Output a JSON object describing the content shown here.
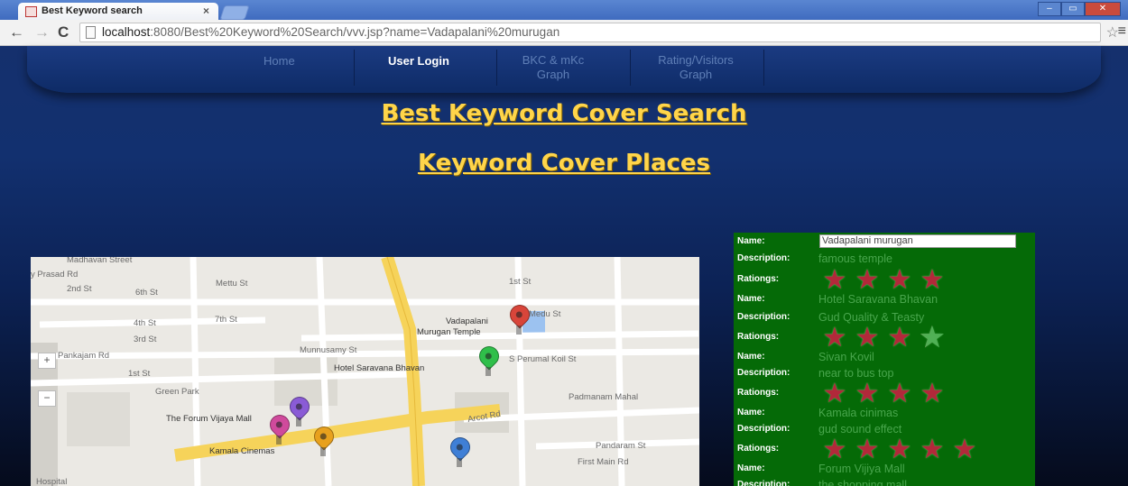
{
  "browser": {
    "tab_title": "Best Keyword search",
    "tab_close": "×",
    "url_host": "localhost",
    "url_rest": ":8080/Best%20Keyword%20Search/vvv.jsp?name=Vadapalani%20murugan",
    "back": "←",
    "forward": "→",
    "reload": "C",
    "star": "☆",
    "menu": "≡",
    "win_min": "–",
    "win_max": "▭",
    "win_close": "✕"
  },
  "nav": {
    "home": "Home",
    "user_login": "User Login",
    "bkc_line1": "BKC & mKc",
    "bkc_line2": "Graph",
    "rating_line1": "Rating/Visitors",
    "rating_line2": "Graph"
  },
  "headings": {
    "main": "Best Keyword Cover Search",
    "sub": "Keyword Cover Places"
  },
  "map": {
    "labels": [
      "Madhavan Street",
      "y Prasad Rd",
      "2nd St",
      "6th St",
      "Mettu St",
      "1st St",
      "4th St",
      "7th St",
      "3rd St",
      "Vadapalani",
      "Murugan Temple",
      "Medu St",
      "Munnusamy St",
      "Pankajam Rd",
      "Hotel Saravana Bhavan",
      "S Perumal Koil St",
      "1st St",
      "Green Park",
      "Padmanam Mahal",
      "The Forum Vijaya Mall",
      "Arcot Rd",
      "Kamala Cinemas",
      "Pandaram St",
      "First Main Rd",
      "Hospital"
    ],
    "zoom_in": "+",
    "zoom_out": "−",
    "pin_colors": [
      "#d8453a",
      "#2fbf4a",
      "#8a5bd6",
      "#d04a9c",
      "#e8a11d",
      "#3f7fd6"
    ]
  },
  "panel": {
    "labels": {
      "name": "Name:",
      "description": "Description:",
      "ratings": "Rationgs:"
    },
    "name_input_value": "Vadapalani murugan",
    "places": [
      {
        "description": "famous temple",
        "rating": 4
      },
      {
        "name": "Hotel Saravana Bhavan",
        "description": "Gud Quality & Teasty",
        "rating": 3.5
      },
      {
        "name": "Sivan Kovil",
        "description": "near to bus top",
        "rating": 4
      },
      {
        "name": "Kamala cinimas",
        "description": "gud sound effect",
        "rating": 5
      },
      {
        "name": "Forum Vijiya Mall",
        "description": "the shopping mall"
      }
    ],
    "star_glyph": "★"
  }
}
